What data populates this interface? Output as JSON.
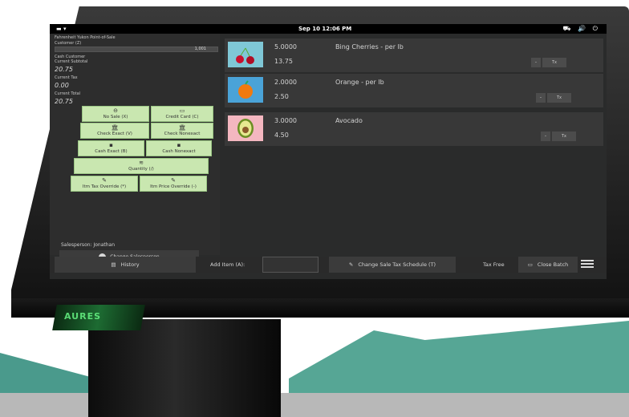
{
  "status_bar": {
    "activities": "▬  ▾",
    "clock": "Sep 10  12:06 PM",
    "system_icons": "⛟ 🔊 ⏻"
  },
  "header": {
    "app_title": "Fahrenheit Yukon Point-of-Sale",
    "customer_label": "Customer (Z)",
    "customer_value": "1,001"
  },
  "summary": {
    "customer_name": "Cash Customer",
    "subtotal_label": "Current Subtotal",
    "subtotal_value": "20.75",
    "tax_label": "Current Tax",
    "tax_value": "0.00",
    "total_label": "Current Total",
    "total_value": "20.75"
  },
  "buttons": {
    "no_sale": "No Sale (X)",
    "credit_card": "Credit Card (C)",
    "check_exact": "Check Exact (V)",
    "check_nonexact": "Check Nonexact",
    "cash_exact": "Cash Exact (B)",
    "cash_nonexact": "Cash Nonexact",
    "quantity": "Quantity (/)",
    "item_tax_override": "Itm Tax Override (*)",
    "item_price_override": "Itm Price Override (-)"
  },
  "salesperson": {
    "label": "Salesperson: Jonathan",
    "change_button": "Change Salesperson"
  },
  "items": [
    {
      "qty": "5.0000",
      "price": "13.75",
      "name": "Bing Cherries - per lb",
      "minus": "-",
      "tax": "Tx"
    },
    {
      "qty": "2.0000",
      "price": "2.50",
      "name": "Orange - per lb",
      "minus": "-",
      "tax": "Tx"
    },
    {
      "qty": "3.0000",
      "price": "4.50",
      "name": "Avocado",
      "minus": "-",
      "tax": "Tx"
    }
  ],
  "toolbar": {
    "history": "History",
    "add_item": "Add Item (A):",
    "change_tax": "Change Sale Tax Schedule (T)",
    "tax_free": "Tax Free",
    "close_batch": "Close Batch"
  },
  "reader": {
    "label": "AURES"
  },
  "colors": {
    "button_green": "#c9e7b0",
    "screen_bg": "#2a2b2b",
    "teal": "#56a695"
  }
}
